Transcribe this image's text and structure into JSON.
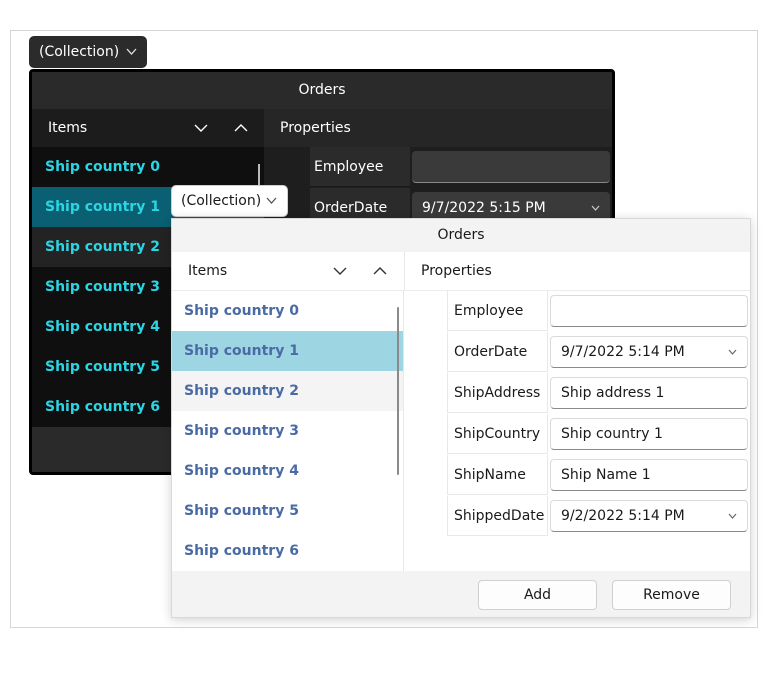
{
  "dark_button": {
    "label": "(Collection)",
    "chevron": "chevron-down-icon"
  },
  "light_button": {
    "label": "(Collection)",
    "chevron": "chevron-down-icon"
  },
  "dark_editor": {
    "title": "Orders",
    "items_header": "Items",
    "properties_header": "Properties",
    "items": [
      "Ship country 0",
      "Ship country 1",
      "Ship country 2",
      "Ship country 3",
      "Ship country 4",
      "Ship country 5",
      "Ship country 6"
    ],
    "selected_index": 1,
    "properties": [
      {
        "name": "Employee",
        "value": ""
      },
      {
        "name": "OrderDate",
        "value": "9/7/2022 5:15 PM"
      }
    ]
  },
  "light_editor": {
    "title": "Orders",
    "items_header": "Items",
    "properties_header": "Properties",
    "items": [
      "Ship country 0",
      "Ship country 1",
      "Ship country 2",
      "Ship country 3",
      "Ship country 4",
      "Ship country 5",
      "Ship country 6"
    ],
    "selected_index": 1,
    "properties": [
      {
        "name": "Employee",
        "value": ""
      },
      {
        "name": "OrderDate",
        "value": "9/7/2022 5:14 PM"
      },
      {
        "name": "ShipAddress",
        "value": "Ship address 1"
      },
      {
        "name": "ShipCountry",
        "value": "Ship country 1"
      },
      {
        "name": "ShipName",
        "value": "Ship Name 1"
      },
      {
        "name": "ShippedDate",
        "value": "9/2/2022 5:14 PM"
      }
    ],
    "add_label": "Add",
    "remove_label": "Remove"
  },
  "colors": {
    "dark_item_text": "#2ad6e4",
    "dark_selected": "#0a5f72",
    "light_item_text": "#4a6aa5",
    "light_selected": "#9dd5e2"
  }
}
